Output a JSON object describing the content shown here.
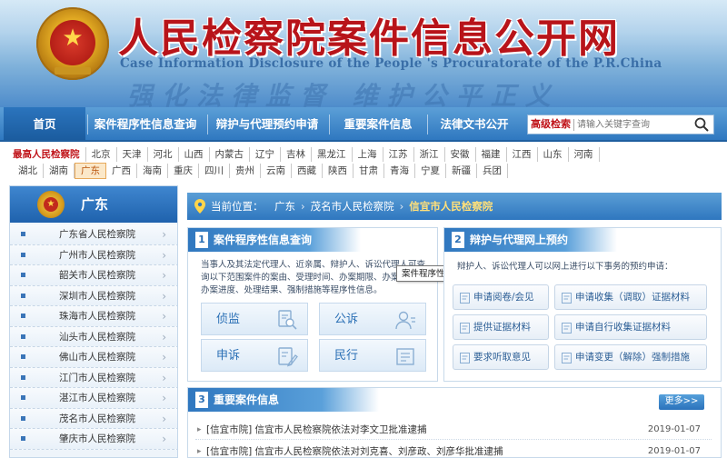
{
  "header": {
    "title": "人民检察院案件信息公开网",
    "subtitle": "Case Information Disclosure of the People 's Procuratorate of the P.R.China",
    "slogan": "强化法律监督 维护公平正义"
  },
  "nav": {
    "items": [
      {
        "label": "首页"
      },
      {
        "label": "案件程序性信息查询"
      },
      {
        "label": "辩护与代理预约申请"
      },
      {
        "label": "重要案件信息"
      },
      {
        "label": "法律文书公开"
      }
    ],
    "search": {
      "advanced_label": "高级检索",
      "placeholder": "请输入关键字查询"
    }
  },
  "regions": {
    "row1": [
      "最高人民检察院",
      "北京",
      "天津",
      "河北",
      "山西",
      "内蒙古",
      "辽宁",
      "吉林",
      "黑龙江",
      "上海",
      "江苏",
      "浙江",
      "安徽",
      "福建",
      "江西",
      "山东",
      "河南"
    ],
    "row2": [
      "湖北",
      "湖南",
      "广东",
      "广西",
      "海南",
      "重庆",
      "四川",
      "贵州",
      "云南",
      "西藏",
      "陕西",
      "甘肃",
      "青海",
      "宁夏",
      "新疆",
      "兵团"
    ],
    "active": "广东"
  },
  "sidebar": {
    "title": "广东",
    "items": [
      {
        "label": "广东省人民检察院"
      },
      {
        "label": "广州市人民检察院"
      },
      {
        "label": "韶关市人民检察院"
      },
      {
        "label": "深圳市人民检察院"
      },
      {
        "label": "珠海市人民检察院"
      },
      {
        "label": "汕头市人民检察院"
      },
      {
        "label": "佛山市人民检察院"
      },
      {
        "label": "江门市人民检察院"
      },
      {
        "label": "湛江市人民检察院"
      },
      {
        "label": "茂名市人民检察院"
      },
      {
        "label": "肇庆市人民检察院"
      }
    ]
  },
  "breadcrumb": {
    "label": "当前位置：",
    "path": [
      "广东",
      "茂名市人民检察院",
      "信宜市人民检察院"
    ]
  },
  "panel1": {
    "num": "1",
    "title": "案件程序性信息查询",
    "desc": "当事人及其法定代理人、近亲属、辩护人、诉讼代理人可查询以下范围案件的案由、受理时间、办案期限、办案部门、办案进度、处理结果、强制措施等程序性信息。",
    "categories": [
      {
        "label": "侦监",
        "icon": "search-doc-icon"
      },
      {
        "label": "公诉",
        "icon": "person-icon"
      },
      {
        "label": "申诉",
        "icon": "pencil-doc-icon"
      },
      {
        "label": "民行",
        "icon": "building-icon"
      }
    ],
    "tooltip": "案件程序性信息查询"
  },
  "panel2": {
    "num": "2",
    "title": "辩护与代理网上预约",
    "desc": "辩护人、诉讼代理人可以网上进行以下事务的预约申请：",
    "services": [
      {
        "label": "申请阅卷/会见"
      },
      {
        "label": "申请收集（调取）证据材料"
      },
      {
        "label": "提供证据材料"
      },
      {
        "label": "申请自行收集证据材料"
      },
      {
        "label": "要求听取意见"
      },
      {
        "label": "申请变更（解除）强制措施"
      }
    ]
  },
  "cases": {
    "num": "3",
    "title": "重要案件信息",
    "more_label": "更多>>",
    "rows": [
      {
        "title": "[信宜市院] 信宜市人民检察院依法对李文卫批准逮捕",
        "date": "2019-01-07"
      },
      {
        "title": "[信宜市院] 信宜市人民检察院依法对刘克喜、刘彦政、刘彦华批准逮捕",
        "date": "2019-01-07"
      }
    ]
  },
  "colors": {
    "accent": "#2f77bf",
    "title_red": "#b8141a",
    "highlight": "#ffe07a"
  }
}
